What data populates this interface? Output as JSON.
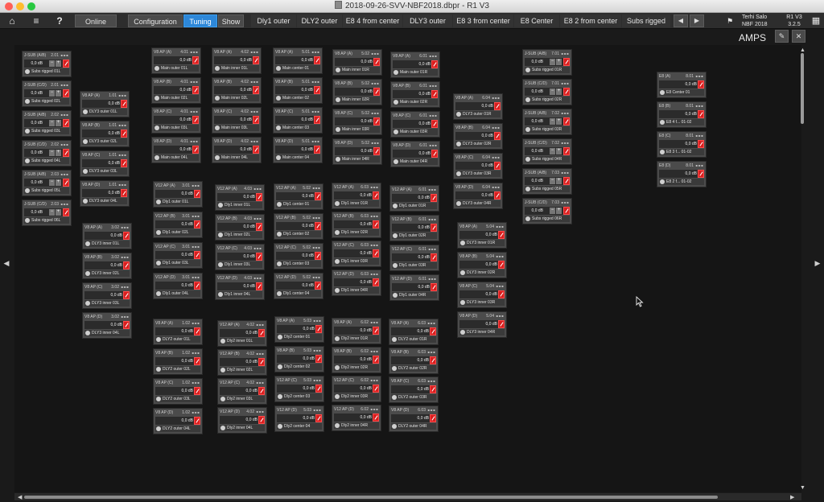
{
  "window": {
    "title": "2018-09-26-SVV-NBF2018.dbpr - R1 V3",
    "traffic_lights": [
      "#ff5f57",
      "#febc2e",
      "#28c840"
    ]
  },
  "toolbar": {
    "home_icon": "home-icon",
    "menu_icon": "menu-icon",
    "help_icon": "help-icon",
    "online_label": "Online",
    "modes": [
      "Configuration",
      "Tuning",
      "Show"
    ],
    "active_mode": "Tuning",
    "scenes": [
      "Dly1 outer",
      "DLY2 outer",
      "E8 4 from center",
      "DLY3 outer",
      "E8 3 from center",
      "E8 Center",
      "E8 2 from center",
      "Subs rigged"
    ],
    "prev_icon": "chevron-left-icon",
    "next_icon": "chevron-right-icon",
    "flag_icon": "flag-icon",
    "user_name": "Terhi Salo",
    "project_name": "NBF 2018",
    "device_label": "R1 V3",
    "version": "3.2.5",
    "grid_icon": "grid-icon",
    "accent_color": "#2d87d8"
  },
  "view": {
    "title": "AMPS",
    "edit_icon": "pencil-icon",
    "close_icon": "close-icon"
  },
  "columns": [
    [
      {
        "ch": "J-SUB (A/B)",
        "num": "2.01",
        "gain": "0,0 dB",
        "name": "Subs rigged 01L"
      },
      {
        "ch": "J-SUB (C/D)",
        "num": "2.01",
        "gain": "0,0 dB",
        "name": "Subs rigged 02L"
      },
      {
        "ch": "J-SUB (A/B)",
        "num": "2.02",
        "gain": "0,0 dB",
        "name": "Subs rigged 03L"
      },
      {
        "ch": "J-SUB (C/D)",
        "num": "2.02",
        "gain": "0,0 dB",
        "name": "Subs rigged 04L"
      },
      {
        "ch": "J-SUB (A/B)",
        "num": "2.03",
        "gain": "0,0 dB",
        "name": "Subs rigged 05L"
      },
      {
        "ch": "J-SUB (C/D)",
        "num": "2.03",
        "gain": "0,0 dB",
        "name": "Subs rigged 06L"
      }
    ],
    [
      {
        "ch": "V8 AP (A)",
        "num": "1.01",
        "gain": "0,0 dB",
        "name": "DLY3 outer 01L"
      },
      {
        "ch": "V8 AP (B)",
        "num": "1.01",
        "gain": "0,0 dB",
        "name": "DLY3 outer 02L"
      },
      {
        "ch": "V8 AP (C)",
        "num": "1.01",
        "gain": "0,0 dB",
        "name": "DLY3 outer 03L"
      },
      {
        "ch": "V8 AP (D)",
        "num": "1.01",
        "gain": "0,0 dB",
        "name": "DLY3 outer 04L"
      }
    ],
    [
      {
        "ch": "V8 AP (A)",
        "num": "3.02",
        "gain": "0,0 dB",
        "name": "DLY3 inner 01L"
      },
      {
        "ch": "V8 AP (B)",
        "num": "3.02",
        "gain": "0,0 dB",
        "name": "DLY3 inner 02L"
      },
      {
        "ch": "V8 AP (C)",
        "num": "3.02",
        "gain": "0,0 dB",
        "name": "DLY3 inner 03L"
      },
      {
        "ch": "V8 AP (D)",
        "num": "3.02",
        "gain": "0,0 dB",
        "name": "DLY3 inner 04L"
      }
    ],
    [
      {
        "ch": "V8 AP (A)",
        "num": "4.01",
        "gain": "0,0 dB",
        "name": "Main outer 01L"
      },
      {
        "ch": "V8 AP (B)",
        "num": "4.01",
        "gain": "0,0 dB",
        "name": "Main outer 02L"
      },
      {
        "ch": "V8 AP (C)",
        "num": "4.01",
        "gain": "0,0 dB",
        "name": "Main outer 03L"
      },
      {
        "ch": "V8 AP (D)",
        "num": "4.01",
        "gain": "0,0 dB",
        "name": "Main outer 04L"
      }
    ],
    [
      {
        "ch": "V12 AP (A)",
        "num": "3.01",
        "gain": "0,0 dB",
        "name": "Dly1 outer 01L"
      },
      {
        "ch": "V12 AP (B)",
        "num": "3.01",
        "gain": "0,0 dB",
        "name": "Dly1 outer 02L"
      },
      {
        "ch": "V12 AP (C)",
        "num": "3.01",
        "gain": "0,0 dB",
        "name": "Dly1 outer 03L"
      },
      {
        "ch": "V12 AP (D)",
        "num": "3.01",
        "gain": "0,0 dB",
        "name": "Dly1 outer 04L"
      }
    ],
    [
      {
        "ch": "V8 AP (A)",
        "num": "1.02",
        "gain": "0,0 dB",
        "name": "DLY2 outer 01L"
      },
      {
        "ch": "V8 AP (B)",
        "num": "1.02",
        "gain": "0,0 dB",
        "name": "DLY2 outer 02L"
      },
      {
        "ch": "V8 AP (C)",
        "num": "1.02",
        "gain": "0,0 dB",
        "name": "DLY2 outer 03L"
      },
      {
        "ch": "V8 AP (D)",
        "num": "1.02",
        "gain": "0,0 dB",
        "name": "DLY2 outer 04L"
      }
    ],
    [
      {
        "ch": "V8 AP (A)",
        "num": "4.02",
        "gain": "0,0 dB",
        "name": "Main inner 01L"
      },
      {
        "ch": "V8 AP (B)",
        "num": "4.02",
        "gain": "0,0 dB",
        "name": "Main inner 02L"
      },
      {
        "ch": "V8 AP (C)",
        "num": "4.02",
        "gain": "0,0 dB",
        "name": "Main inner 03L"
      },
      {
        "ch": "V8 AP (D)",
        "num": "4.02",
        "gain": "0,0 dB",
        "name": "Main inner 04L"
      }
    ],
    [
      {
        "ch": "V12 AP (A)",
        "num": "4.03",
        "gain": "0,0 dB",
        "name": "Dly1 inner 01L"
      },
      {
        "ch": "V12 AP (B)",
        "num": "4.03",
        "gain": "0,0 dB",
        "name": "Dly1 inner 02L"
      },
      {
        "ch": "V12 AP (C)",
        "num": "4.03",
        "gain": "0,0 dB",
        "name": "Dly1 inner 03L"
      },
      {
        "ch": "V12 AP (D)",
        "num": "4.03",
        "gain": "0,0 dB",
        "name": "Dly1 inner 04L"
      }
    ],
    [
      {
        "ch": "V12 AP (A)",
        "num": "4.02",
        "gain": "0,0 dB",
        "name": "Dly2 inner 01L"
      },
      {
        "ch": "V12 AP (B)",
        "num": "4.02",
        "gain": "0,0 dB",
        "name": "Dly2 inner 02L"
      },
      {
        "ch": "V12 AP (C)",
        "num": "4.02",
        "gain": "0,0 dB",
        "name": "Dly2 inner 03L"
      },
      {
        "ch": "V12 AP (D)",
        "num": "4.02",
        "gain": "0,0 dB",
        "name": "Dly2 inner 04L"
      }
    ],
    [
      {
        "ch": "V8 AP (A)",
        "num": "5.01",
        "gain": "0,0 dB",
        "name": "Main center 01"
      },
      {
        "ch": "V8 AP (B)",
        "num": "5.01",
        "gain": "0,0 dB",
        "name": "Main center 02"
      },
      {
        "ch": "V8 AP (C)",
        "num": "5.01",
        "gain": "0,0 dB",
        "name": "Main center 03"
      },
      {
        "ch": "V8 AP (D)",
        "num": "5.01",
        "gain": "0,0 dB",
        "name": "Main center 04"
      }
    ],
    [
      {
        "ch": "V12 AP (A)",
        "num": "5.02",
        "gain": "0,0 dB",
        "name": "Dly1 center 01"
      },
      {
        "ch": "V12 AP (B)",
        "num": "5.02",
        "gain": "0,0 dB",
        "name": "Dly1 center 02"
      },
      {
        "ch": "V12 AP (C)",
        "num": "5.02",
        "gain": "0,0 dB",
        "name": "Dly1 center 03"
      },
      {
        "ch": "V12 AP (D)",
        "num": "5.02",
        "gain": "0,0 dB",
        "name": "Dly1 center 04"
      }
    ],
    [
      {
        "ch": "V8 AP (A)",
        "num": "5.03",
        "gain": "0,0 dB",
        "name": "Dly2 center 01"
      },
      {
        "ch": "V8 AP (B)",
        "num": "5.03",
        "gain": "0,0 dB",
        "name": "Dly2 center 02"
      },
      {
        "ch": "V12 AP (C)",
        "num": "5.03",
        "gain": "0,0 dB",
        "name": "Dly2 center 03"
      },
      {
        "ch": "V12 AP (D)",
        "num": "5.03",
        "gain": "0,0 dB",
        "name": "Dly2 center 04"
      }
    ],
    [
      {
        "ch": "V8 AP (A)",
        "num": "5.02",
        "gain": "0,0 dB",
        "name": "Main inner 01R"
      },
      {
        "ch": "V8 AP (B)",
        "num": "5.02",
        "gain": "0,0 dB",
        "name": "Main inner 02R"
      },
      {
        "ch": "V8 AP (C)",
        "num": "5.02",
        "gain": "0,0 dB",
        "name": "Main inner 03R"
      },
      {
        "ch": "V8 AP (D)",
        "num": "5.02",
        "gain": "0,0 dB",
        "name": "Main inner 04R"
      }
    ],
    [
      {
        "ch": "V12 AP (A)",
        "num": "6.03",
        "gain": "0,0 dB",
        "name": "Dly1 inner 01R"
      },
      {
        "ch": "V12 AP (B)",
        "num": "6.03",
        "gain": "0,0 dB",
        "name": "Dly1 inner 02R"
      },
      {
        "ch": "V12 AP (C)",
        "num": "6.03",
        "gain": "0,0 dB",
        "name": "Dly1 inner 03R"
      },
      {
        "ch": "V12 AP (D)",
        "num": "6.03",
        "gain": "0,0 dB",
        "name": "Dly1 inner 04R"
      }
    ],
    [
      {
        "ch": "V8 AP (A)",
        "num": "6.02",
        "gain": "0,0 dB",
        "name": "Dly2 inner 01R"
      },
      {
        "ch": "V8 AP (B)",
        "num": "6.02",
        "gain": "0,0 dB",
        "name": "Dly2 inner 02R"
      },
      {
        "ch": "V12 AP (C)",
        "num": "6.02",
        "gain": "0,0 dB",
        "name": "Dly2 inner 03R"
      },
      {
        "ch": "V12 AP (D)",
        "num": "6.02",
        "gain": "0,0 dB",
        "name": "Dly2 inner 04R"
      }
    ],
    [
      {
        "ch": "V8 AP (A)",
        "num": "6.01",
        "gain": "0,0 dB",
        "name": "Main outer 01R"
      },
      {
        "ch": "V8 AP (B)",
        "num": "6.01",
        "gain": "0,0 dB",
        "name": "Main outer 02R"
      },
      {
        "ch": "V8 AP (C)",
        "num": "6.01",
        "gain": "0,0 dB",
        "name": "Main outer 03R"
      },
      {
        "ch": "V8 AP (D)",
        "num": "6.01",
        "gain": "0,0 dB",
        "name": "Main outer 04R"
      }
    ],
    [
      {
        "ch": "V12 AP (A)",
        "num": "6.01",
        "gain": "0,0 dB",
        "name": "Dly1 outer 01R"
      },
      {
        "ch": "V12 AP (B)",
        "num": "6.01",
        "gain": "0,0 dB",
        "name": "Dly1 outer 02R"
      },
      {
        "ch": "V12 AP (C)",
        "num": "6.01",
        "gain": "0,0 dB",
        "name": "Dly1 outer 03R"
      },
      {
        "ch": "V12 AP (D)",
        "num": "6.01",
        "gain": "0,0 dB",
        "name": "Dly1 outer 04R"
      }
    ],
    [
      {
        "ch": "V8 AP (A)",
        "num": "6.03",
        "gain": "0,0 dB",
        "name": "DLY2 outer 01R"
      },
      {
        "ch": "V8 AP (B)",
        "num": "6.03",
        "gain": "0,0 dB",
        "name": "DLY2 outer 02R"
      },
      {
        "ch": "V8 AP (C)",
        "num": "6.03",
        "gain": "0,0 dB",
        "name": "DLY2 outer 03R"
      },
      {
        "ch": "V8 AP (D)",
        "num": "6.03",
        "gain": "0,0 dB",
        "name": "DLY2 outer 04R"
      }
    ],
    [
      {
        "ch": "V8 AP (A)",
        "num": "6.04",
        "gain": "0,0 dB",
        "name": "DLY3 outer 01R"
      },
      {
        "ch": "V8 AP (B)",
        "num": "6.04",
        "gain": "0,0 dB",
        "name": "DLY3 outer 02R"
      },
      {
        "ch": "V8 AP (C)",
        "num": "6.04",
        "gain": "0,0 dB",
        "name": "DLY3 outer 03R"
      },
      {
        "ch": "V8 AP (D)",
        "num": "6.04",
        "gain": "0,0 dB",
        "name": "DLY3 outer 04R"
      }
    ],
    [
      {
        "ch": "V8 AP (A)",
        "num": "5.04",
        "gain": "0,0 dB",
        "name": "DLY3 inner 01R"
      },
      {
        "ch": "V8 AP (B)",
        "num": "5.04",
        "gain": "0,0 dB",
        "name": "DLY3 inner 02R"
      },
      {
        "ch": "V8 AP (C)",
        "num": "5.04",
        "gain": "0,0 dB",
        "name": "DLY3 inner 03R"
      },
      {
        "ch": "V8 AP (D)",
        "num": "5.04",
        "gain": "0,0 dB",
        "name": "DLY3 inner 04R"
      }
    ],
    [
      {
        "ch": "J-SUB (A/B)",
        "num": "7.01",
        "gain": "0,0 dB",
        "name": "Subs rigged 01R"
      },
      {
        "ch": "J-SUB (C/D)",
        "num": "7.01",
        "gain": "0,0 dB",
        "name": "Subs rigged 02R"
      },
      {
        "ch": "J-SUB (A/B)",
        "num": "7.02",
        "gain": "0,0 dB",
        "name": "Subs rigged 03R"
      },
      {
        "ch": "J-SUB (C/D)",
        "num": "7.02",
        "gain": "0,0 dB",
        "name": "Subs rigged 04R"
      },
      {
        "ch": "J-SUB (A/B)",
        "num": "7.03",
        "gain": "0,0 dB",
        "name": "Subs rigged 05R"
      },
      {
        "ch": "J-SUB (C/D)",
        "num": "7.03",
        "gain": "0,0 dB",
        "name": "Subs rigged 06R"
      }
    ],
    [
      {
        "ch": "E8 (A)",
        "num": "8.01",
        "gain": "0,0 dB",
        "name": "E8 Center 01"
      },
      {
        "ch": "E8 (B)",
        "num": "8.01",
        "gain": "0,0 dB",
        "name": "E8 4 f... 01-02"
      },
      {
        "ch": "E8 (C)",
        "num": "8.01",
        "gain": "0,0 dB",
        "name": "E8 3 f... 01-02"
      },
      {
        "ch": "E8 (D)",
        "num": "8.01",
        "gain": "0,0 dB",
        "name": "E8 2 f... 01-02"
      }
    ]
  ]
}
